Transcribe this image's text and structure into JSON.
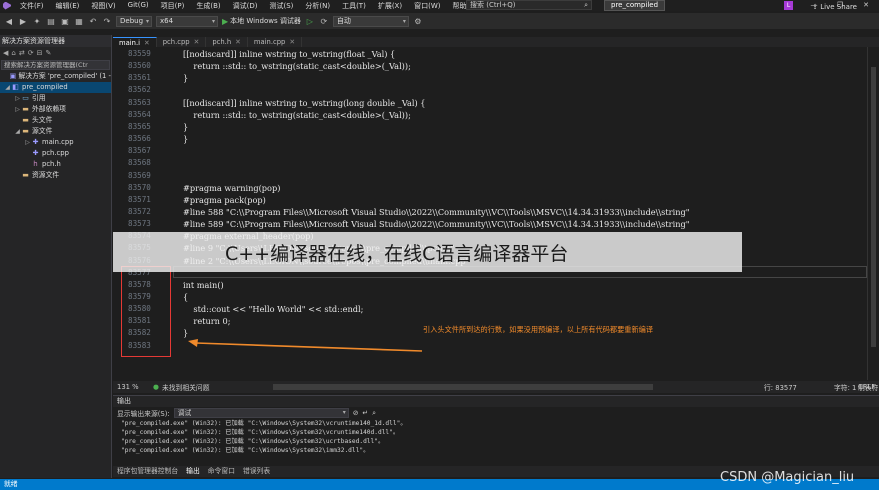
{
  "menu": {
    "items": [
      "文件(F)",
      "编辑(E)",
      "视图(V)",
      "Git(G)",
      "项目(P)",
      "生成(B)",
      "调试(D)",
      "测试(S)",
      "分析(N)",
      "工具(T)",
      "扩展(X)",
      "窗口(W)",
      "帮助(H)"
    ],
    "search_placeholder": "搜索 (Ctrl+Q)",
    "project_name": "pre_compiled",
    "avatar_letter": "L"
  },
  "toolbar": {
    "config": "Debug",
    "platform": "x64",
    "run_label": "本地 Windows 调试器",
    "auto": "自动",
    "live_share": "Live Share"
  },
  "solution_explorer": {
    "title": "解决方案资源管理器",
    "search_placeholder": "搜索解决方案资源管理器(Ctr",
    "tree": [
      {
        "label": "解决方案 'pre_compiled' (1 -",
        "level": 0,
        "icon": "solution",
        "expander": ""
      },
      {
        "label": "pre_compiled",
        "level": 0,
        "icon": "project",
        "expander": "◢",
        "selected": true
      },
      {
        "label": "引用",
        "level": 1,
        "icon": "ref",
        "expander": "▷"
      },
      {
        "label": "外部依赖项",
        "level": 1,
        "icon": "folder",
        "expander": "▷"
      },
      {
        "label": "头文件",
        "level": 1,
        "icon": "folder",
        "expander": ""
      },
      {
        "label": "源文件",
        "level": 1,
        "icon": "folder",
        "expander": "◢"
      },
      {
        "label": "main.cpp",
        "level": 2,
        "icon": "cpp",
        "expander": "▷"
      },
      {
        "label": "pch.cpp",
        "level": 2,
        "icon": "cpp",
        "expander": ""
      },
      {
        "label": "pch.h",
        "level": 2,
        "icon": "h",
        "expander": ""
      },
      {
        "label": "资源文件",
        "level": 1,
        "icon": "folder",
        "expander": ""
      }
    ]
  },
  "tabs": [
    {
      "label": "main.i",
      "active": true
    },
    {
      "label": "pch.cpp",
      "active": false
    },
    {
      "label": "pch.h",
      "active": false
    },
    {
      "label": "main.cpp",
      "active": false
    }
  ],
  "editor": {
    "lines": [
      {
        "n": "83559",
        "code": "[[nodiscard]] inline wstring to_wstring(float _Val) {"
      },
      {
        "n": "83560",
        "code": "    return ::std:: to_wstring(static_cast<double>(_Val));"
      },
      {
        "n": "83561",
        "code": "}"
      },
      {
        "n": "83562",
        "code": ""
      },
      {
        "n": "83563",
        "code": "[[nodiscard]] inline wstring to_wstring(long double _Val) {"
      },
      {
        "n": "83564",
        "code": "    return ::std:: to_wstring(static_cast<double>(_Val));"
      },
      {
        "n": "83565",
        "code": "}"
      },
      {
        "n": "83566",
        "code": "}"
      },
      {
        "n": "83567",
        "code": ""
      },
      {
        "n": "83568",
        "code": ""
      },
      {
        "n": "83569",
        "code": ""
      },
      {
        "n": "83570",
        "code": "#pragma warning(pop)"
      },
      {
        "n": "83571",
        "code": "#pragma pack(pop)"
      },
      {
        "n": "83572",
        "code": "#line 588 \"C:\\\\Program Files\\\\Microsoft Visual Studio\\\\2022\\\\Community\\\\VC\\\\Tools\\\\MSVC\\\\14.34.31933\\\\include\\\\string\""
      },
      {
        "n": "83573",
        "code": "#line 589 \"C:\\\\Program Files\\\\Microsoft Visual Studio\\\\2022\\\\Community\\\\VC\\\\Tools\\\\MSVC\\\\14.34.31933\\\\include\\\\string\""
      },
      {
        "n": "83574",
        "code": "#pragma external_header(pop)"
      },
      {
        "n": "83575",
        "code": "#line 9 \"C:\\\\Users\\\\LEGION\\\\source\\\\repos\\\\pre_compiled\\\\pch.h\""
      },
      {
        "n": "83576",
        "code": "#line 2 \"C:\\\\Users\\\\LEGION\\\\source\\\\repos\\\\pre_compiled\\\\main.cpp\""
      },
      {
        "n": "83577",
        "code": ""
      },
      {
        "n": "83578",
        "code": "int main()"
      },
      {
        "n": "83579",
        "code": "{"
      },
      {
        "n": "83580",
        "code": "    std::cout << \"Hello World\" << std::endl;"
      },
      {
        "n": "83581",
        "code": "    return 0;"
      },
      {
        "n": "83582",
        "code": "}"
      },
      {
        "n": "83583",
        "code": ""
      }
    ],
    "annotation": "引入头文件所到达的行数，如果没用预编译，以上所有代码都要重新编译",
    "banner": "C++编译器在线，在线C语言编译器平台"
  },
  "editor_status": {
    "zoom": "131 %",
    "issues": "未找到相关问题",
    "line": "行: 83577",
    "char": "字符: 1",
    "tab": "制表符",
    "eol": "CRLF"
  },
  "output": {
    "title": "输出",
    "source_label": "显示输出来源(S):",
    "source_value": "调试",
    "lines": [
      "\"pre_compiled.exe\" (Win32): 已加载 \"C:\\Windows\\System32\\vcruntime140_1d.dll\"。",
      "\"pre_compiled.exe\" (Win32): 已加载 \"C:\\Windows\\System32\\vcruntime140d.dll\"。",
      "\"pre_compiled.exe\" (Win32): 已加载 \"C:\\Windows\\System32\\ucrtbased.dll\"。",
      "\"pre_compiled.exe\" (Win32): 已加载 \"C:\\Windows\\System32\\imm32.dll\"。"
    ]
  },
  "bottom_tabs": [
    {
      "label": "程序包管理器控制台",
      "active": false
    },
    {
      "label": "输出",
      "active": true
    },
    {
      "label": "命令窗口",
      "active": false
    },
    {
      "label": "错误列表",
      "active": false
    }
  ],
  "statusbar": {
    "text": "就绪"
  },
  "watermark": "CSDN @Magician_liu"
}
